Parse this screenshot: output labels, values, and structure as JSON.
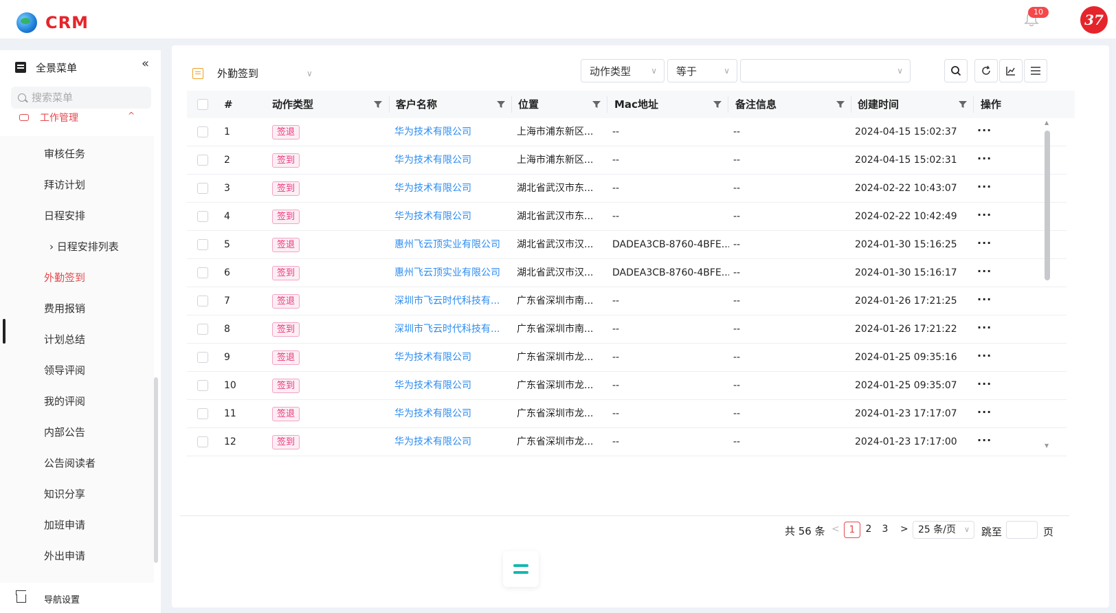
{
  "app": {
    "logo_text": "CRM",
    "notification_count": "10",
    "avatar_text": "37"
  },
  "sidebar": {
    "full_menu_label": "全景菜单",
    "collapse_glyph": "«",
    "search_placeholder": "搜索菜单",
    "group_label": "工作管理",
    "items": [
      {
        "label": "审核任务",
        "active": false
      },
      {
        "label": "拜访计划",
        "active": false
      },
      {
        "label": "日程安排",
        "active": false
      },
      {
        "label": "日程安排列表",
        "active": false,
        "nested": true
      },
      {
        "label": "外勤签到",
        "active": true
      },
      {
        "label": "费用报销",
        "active": false
      },
      {
        "label": "计划总结",
        "active": false
      },
      {
        "label": "领导评阅",
        "active": false
      },
      {
        "label": "我的评阅",
        "active": false
      },
      {
        "label": "内部公告",
        "active": false
      },
      {
        "label": "公告阅读者",
        "active": false
      },
      {
        "label": "知识分享",
        "active": false
      },
      {
        "label": "加班申请",
        "active": false
      },
      {
        "label": "外出申请",
        "active": false
      }
    ],
    "nav_settings_label": "导航设置"
  },
  "toolbar": {
    "view_title": "外勤签到",
    "filter_field": "动作类型",
    "filter_operator": "等于",
    "filter_value": ""
  },
  "table": {
    "columns": [
      "#",
      "动作类型",
      "客户名称",
      "位置",
      "Mac地址",
      "备注信息",
      "创建时间",
      "操作"
    ],
    "rows": [
      {
        "no": "1",
        "action": "签退",
        "customer": "华为技术有限公司",
        "location": "上海市浦东新区...",
        "mac": "--",
        "note": "--",
        "created": "2024-04-15 15:02:37"
      },
      {
        "no": "2",
        "action": "签到",
        "customer": "华为技术有限公司",
        "location": "上海市浦东新区...",
        "mac": "--",
        "note": "--",
        "created": "2024-04-15 15:02:31"
      },
      {
        "no": "3",
        "action": "签到",
        "customer": "华为技术有限公司",
        "location": "湖北省武汉市东...",
        "mac": "--",
        "note": "--",
        "created": "2024-02-22 10:43:07"
      },
      {
        "no": "4",
        "action": "签到",
        "customer": "华为技术有限公司",
        "location": "湖北省武汉市东...",
        "mac": "--",
        "note": "--",
        "created": "2024-02-22 10:42:49"
      },
      {
        "no": "5",
        "action": "签退",
        "customer": "惠州飞云顶实业有限公司",
        "location": "湖北省武汉市汉...",
        "mac": "DADEA3CB-8760-4BFE...",
        "note": "--",
        "created": "2024-01-30 15:16:25"
      },
      {
        "no": "6",
        "action": "签到",
        "customer": "惠州飞云顶实业有限公司",
        "location": "湖北省武汉市汉...",
        "mac": "DADEA3CB-8760-4BFE...",
        "note": "--",
        "created": "2024-01-30 15:16:17"
      },
      {
        "no": "7",
        "action": "签退",
        "customer": "深圳市飞云时代科技有...",
        "location": "广东省深圳市南...",
        "mac": "--",
        "note": "--",
        "created": "2024-01-26 17:21:25"
      },
      {
        "no": "8",
        "action": "签到",
        "customer": "深圳市飞云时代科技有...",
        "location": "广东省深圳市南...",
        "mac": "--",
        "note": "--",
        "created": "2024-01-26 17:21:22"
      },
      {
        "no": "9",
        "action": "签退",
        "customer": "华为技术有限公司",
        "location": "广东省深圳市龙...",
        "mac": "--",
        "note": "--",
        "created": "2024-01-25 09:35:16"
      },
      {
        "no": "10",
        "action": "签到",
        "customer": "华为技术有限公司",
        "location": "广东省深圳市龙...",
        "mac": "--",
        "note": "--",
        "created": "2024-01-25 09:35:07"
      },
      {
        "no": "11",
        "action": "签退",
        "customer": "华为技术有限公司",
        "location": "广东省深圳市龙...",
        "mac": "--",
        "note": "--",
        "created": "2024-01-23 17:17:07"
      },
      {
        "no": "12",
        "action": "签到",
        "customer": "华为技术有限公司",
        "location": "广东省深圳市龙...",
        "mac": "--",
        "note": "--",
        "created": "2024-01-23 17:17:00"
      }
    ],
    "row_action_glyph": "···"
  },
  "pagination": {
    "total": "共 56 条",
    "pages": [
      "1",
      "2",
      "3"
    ],
    "current_page": "1",
    "page_size": "25 条/页",
    "jump_label": "跳至",
    "page_unit": "页"
  },
  "colors": {
    "brand": "#e5252b",
    "active_menu": "#e5484d",
    "link": "#2d8cf0",
    "tag_text": "#e8397d",
    "tag_bg": "#fdeef4",
    "float_icon": "#14b8b0"
  }
}
